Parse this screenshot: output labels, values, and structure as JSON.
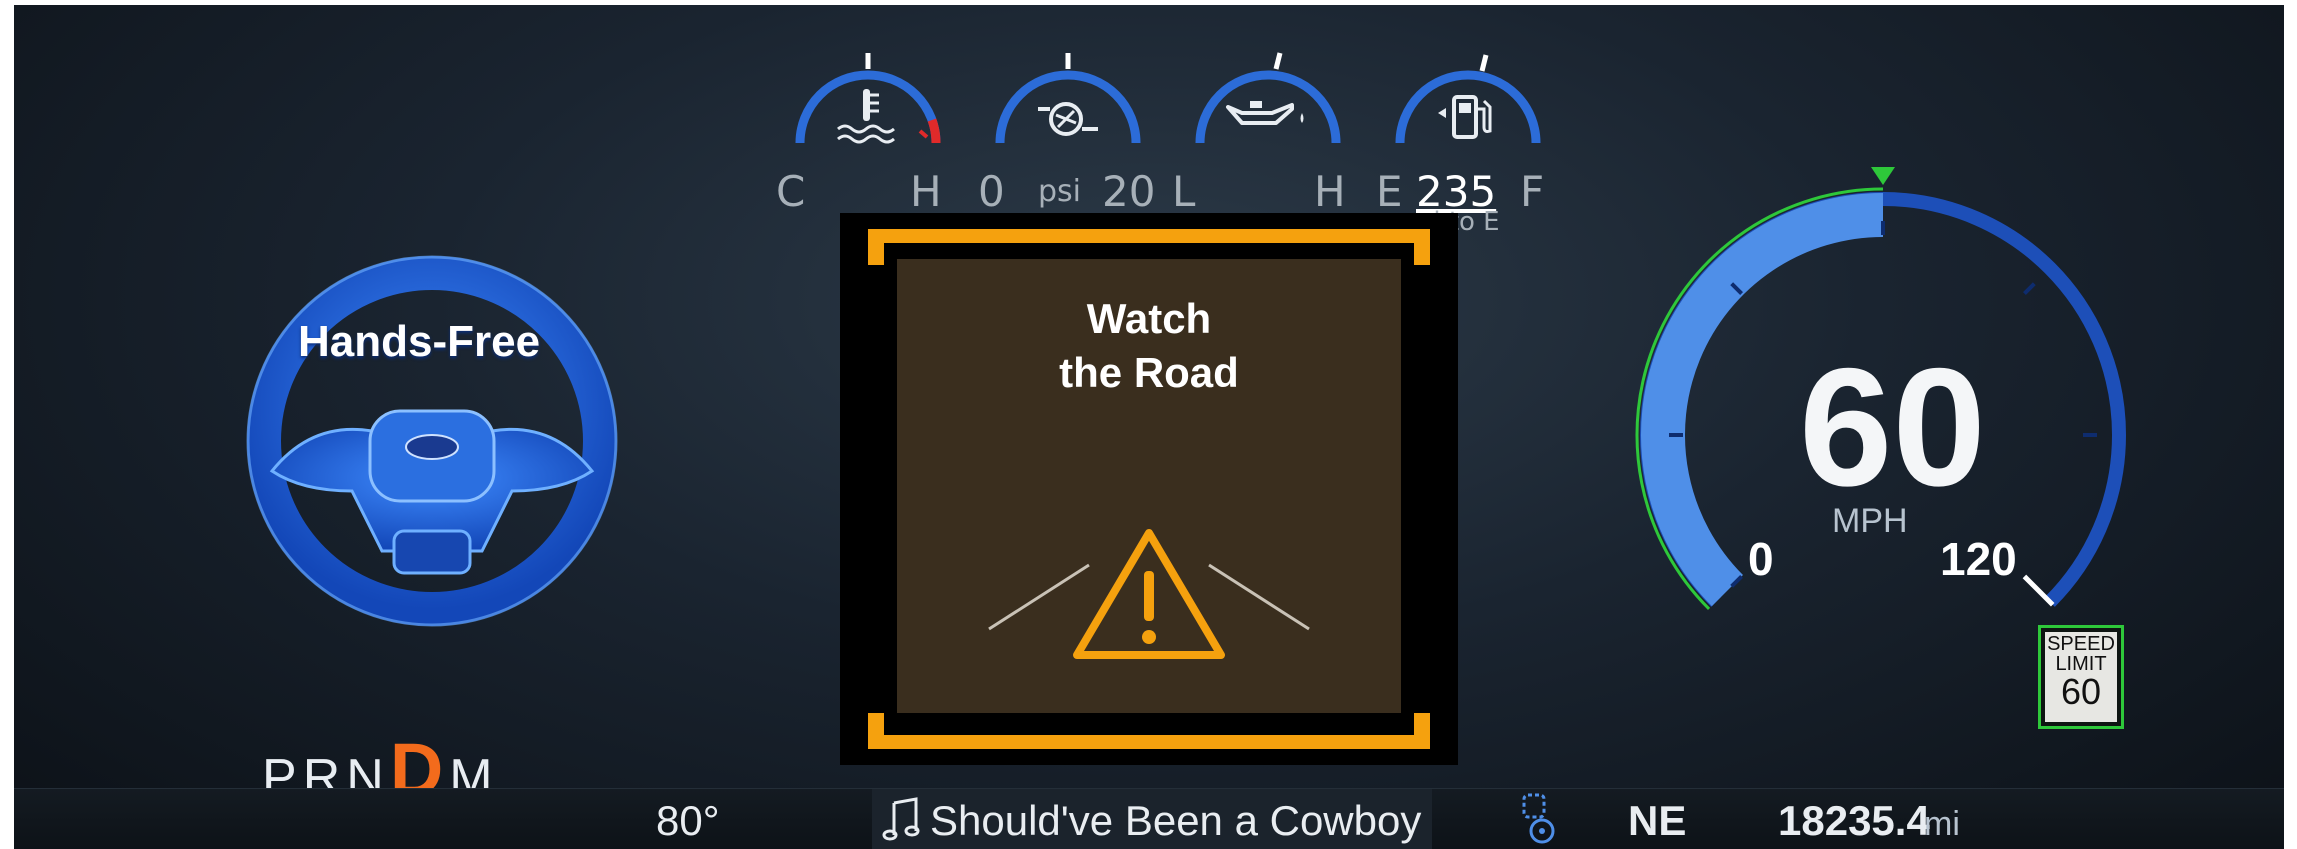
{
  "gauges": {
    "temperature": {
      "icon": "coolant-temperature-icon",
      "min_label": "C",
      "max_label": "H"
    },
    "turbo_boost": {
      "icon": "turbo-icon",
      "min_label": "0",
      "unit": "psi",
      "max_label": "20"
    },
    "oil_pressure": {
      "icon": "oil-can-icon",
      "min_label": "L",
      "max_label": "H"
    },
    "fuel": {
      "icon": "fuel-pump-icon",
      "min_label": "E",
      "range_value": "235",
      "range_unit": "mi to E",
      "max_label": "F"
    }
  },
  "driver_assist": {
    "label": "Hands-Free",
    "icon": "steering-wheel-icon",
    "status_color": "#1f6ee6"
  },
  "alert": {
    "line1": "Watch",
    "line2": "the Road",
    "icon": "warning-triangle-icon",
    "accent_color": "#f5a10e"
  },
  "gear": {
    "gears": [
      "P",
      "R",
      "N",
      "D",
      "M"
    ],
    "selected": "D",
    "selected_color": "#f36b1c"
  },
  "speedometer": {
    "speed": "60",
    "unit": "MPH",
    "min_label": "0",
    "max_label": "120",
    "current_speed": 60,
    "max_speed": 120,
    "set_speed": 60,
    "fill_color": "#4f8fe8",
    "track_color": "#1d4fb8",
    "limit_ring_color": "#2ec83a"
  },
  "speed_limit_sign": {
    "line1": "SPEED",
    "line2": "LIMIT",
    "value": "60"
  },
  "status_bar": {
    "outside_temp": "80°",
    "media_icon": "music-note-icon",
    "media_title": "Should've Been a Cowboy",
    "assist_icon": "lane-centering-icon",
    "compass": "NE",
    "odometer": "18235.4",
    "odometer_unit": "mi"
  }
}
